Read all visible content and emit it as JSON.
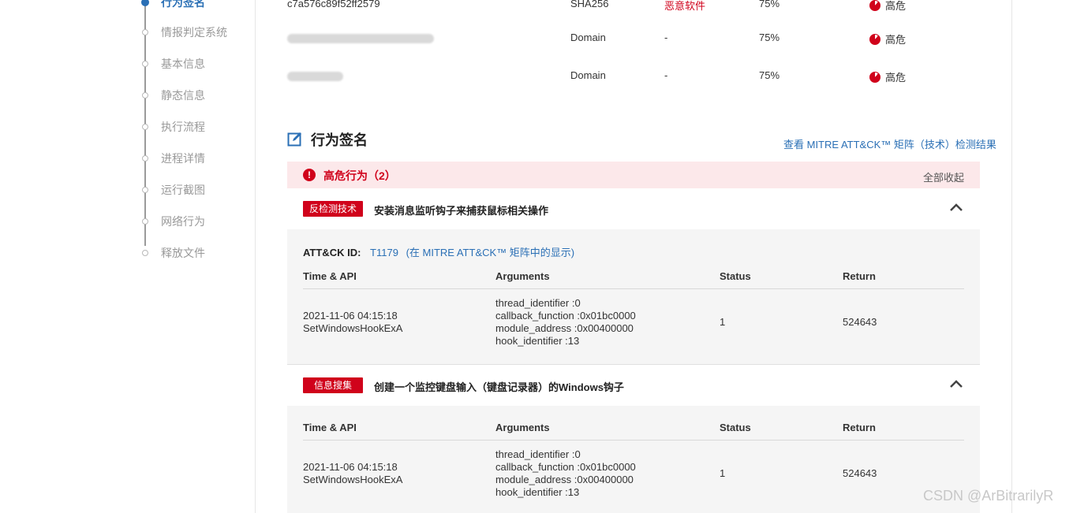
{
  "sidebar": {
    "items": [
      {
        "label": "行为签名",
        "active": true
      },
      {
        "label": "情报判定系统",
        "active": false
      },
      {
        "label": "基本信息",
        "active": false
      },
      {
        "label": "静态信息",
        "active": false
      },
      {
        "label": "执行流程",
        "active": false
      },
      {
        "label": "进程详情",
        "active": false
      },
      {
        "label": "运行截图",
        "active": false
      },
      {
        "label": "网络行为",
        "active": false
      },
      {
        "label": "释放文件",
        "active": false
      }
    ]
  },
  "ioc_rows": [
    {
      "indicator": "c7a576c89f52ff2579",
      "type": "SHA256",
      "tag": "恶意软件",
      "score": "75%",
      "risk": "高危"
    },
    {
      "indicator": "",
      "type": "Domain",
      "tag": "-",
      "score": "75%",
      "risk": "高危"
    },
    {
      "indicator": "",
      "type": "Domain",
      "tag": "-",
      "score": "75%",
      "risk": "高危"
    }
  ],
  "section": {
    "title": "行为签名",
    "mitre_link": "查看 MITRE ATT&CK™ 矩阵（技术）检测结果",
    "icon": "edit-icon"
  },
  "banner": {
    "title": "高危行为（2）",
    "collapse_all": "全部收起"
  },
  "table_headers": {
    "time_api": "Time & API",
    "arguments": "Arguments",
    "status": "Status",
    "return": "Return"
  },
  "entries": [
    {
      "tag": "反检测技术",
      "description": "安装消息监听钩子来捕获鼠标相关操作",
      "attck_label": "ATT&CK ID:",
      "attck_id": "T1179",
      "attck_link": "(在 MITRE ATT&CK™ 矩阵中的显示)",
      "row": {
        "time": "2021-11-06 04:15:18",
        "api": "SetWindowsHookExA",
        "args": [
          "thread_identifier :0",
          "callback_function :0x01bc0000",
          "module_address :0x00400000",
          "hook_identifier :13"
        ],
        "status": "1",
        "return": "524643"
      }
    },
    {
      "tag": "信息搜集",
      "description": "创建一个监控键盘输入（键盘记录器）的Windows钩子",
      "row": {
        "time": "2021-11-06 04:15:18",
        "api": "SetWindowsHookExA",
        "args": [
          "thread_identifier :0",
          "callback_function :0x01bc0000",
          "module_address :0x00400000",
          "hook_identifier :13"
        ],
        "status": "1",
        "return": "524643"
      }
    }
  ],
  "watermark": "CSDN @ArBitrarilyR",
  "colors": {
    "accent": "#2a6fb5",
    "danger": "#d0021b",
    "banner_bg": "#fce8ea"
  }
}
